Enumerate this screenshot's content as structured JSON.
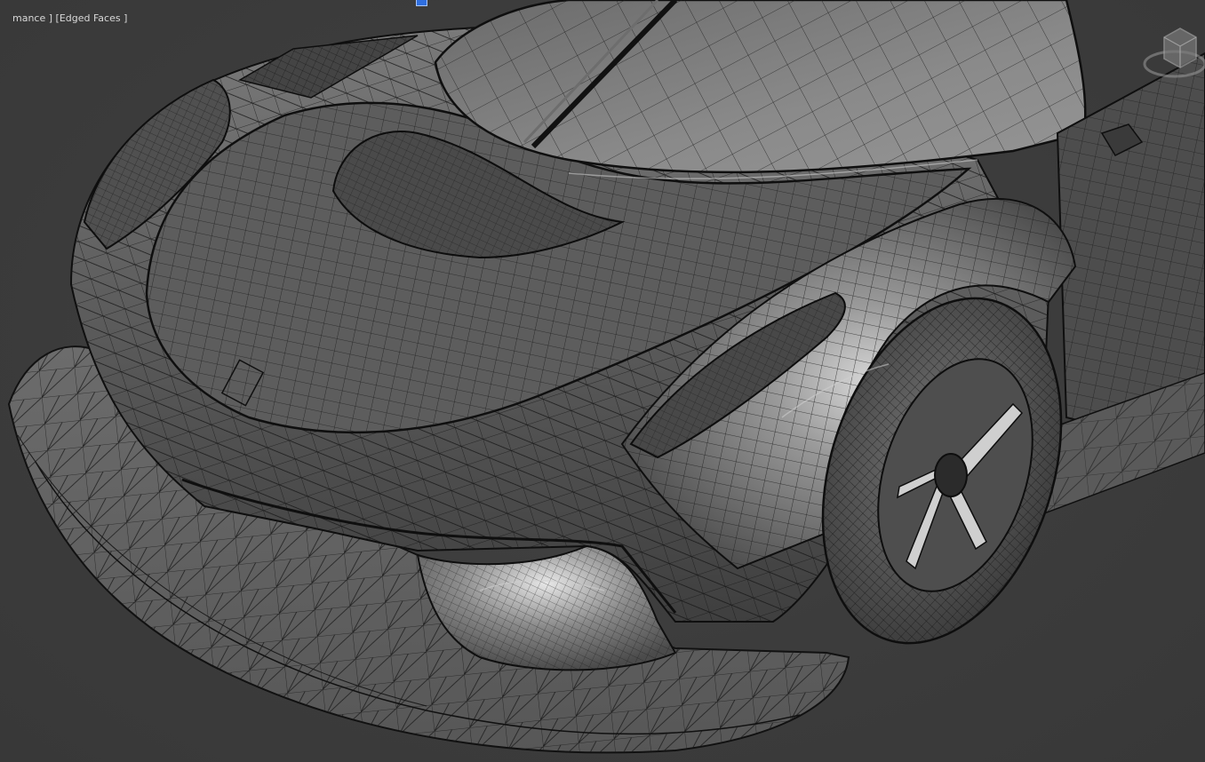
{
  "viewport": {
    "label_shading": "mance ]",
    "label_edges": " [Edged Faces ]",
    "accent_color": "#2f6fe0",
    "background_color": "#3b3b3b",
    "wire_color": "#151515"
  },
  "viewcube": {
    "icon": "viewcube-icon"
  },
  "scene": {
    "object": "car-front-wireframe-mesh"
  }
}
